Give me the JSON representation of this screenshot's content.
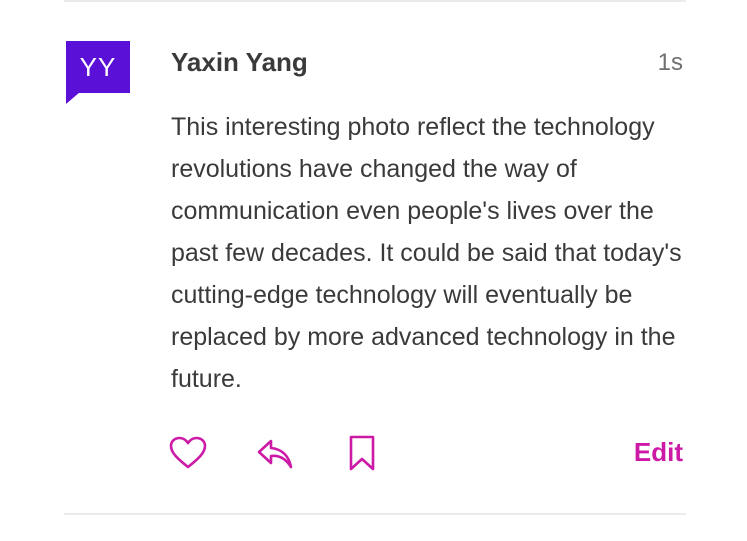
{
  "colors": {
    "avatar_bg": "#5a10d6",
    "accent": "#cc1aa6",
    "text": "#3a3a3a",
    "muted": "#6f6f6f",
    "divider": "#ebebeb"
  },
  "comment": {
    "avatar_initials": "YY",
    "author": "Yaxin Yang",
    "timestamp": "1s",
    "body": "This interesting photo reflect the technology revolutions have changed the way of communication even people's lives over the past few decades. It could be said that today's cutting-edge technology will eventually be replaced by more advanced technology in the future."
  },
  "actions": {
    "like_icon": "heart-icon",
    "reply_icon": "reply-arrow-icon",
    "bookmark_icon": "bookmark-icon",
    "edit_label": "Edit"
  }
}
